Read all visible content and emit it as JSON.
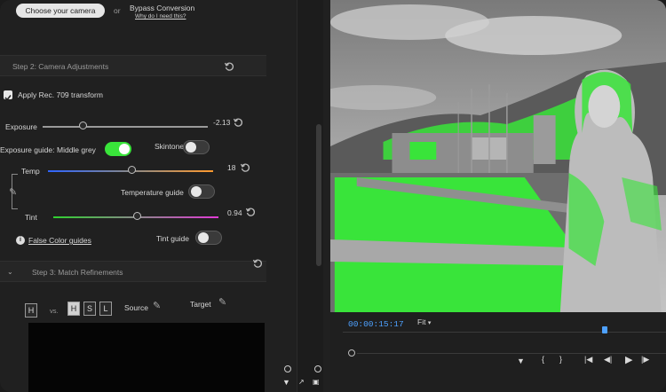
{
  "topbar": {
    "camera_button": "Choose your camera",
    "or_text": "or",
    "bypass_label": "Bypass Conversion",
    "why_link": "Why do I need this?"
  },
  "step2": {
    "title": "Step 2: Camera Adjustments",
    "apply_rec709_label": "Apply Rec. 709 transform",
    "apply_rec709_checked": true,
    "exposure_label": "Exposure",
    "exposure_value": "-2.13",
    "exposure_level": 0.3,
    "exposure_guide_label": "Exposure guide:",
    "middle_grey_label": "Middle grey",
    "middle_grey_on": true,
    "skintones_label": "Skintones",
    "skintones_on": false,
    "temp_label": "Temp",
    "temp_value": "18",
    "temp_level": 0.5,
    "temperature_guide_label": "Temperature guide",
    "temperature_guide_on": false,
    "tint_label": "Tint",
    "tint_value": "0.94",
    "tint_level": 0.5,
    "false_color_link": "False Color guides",
    "tint_guide_label": "Tint guide",
    "tint_guide_on": false
  },
  "step3": {
    "title": "Step 3: Match Refinements",
    "h_label": "H",
    "vs_label": "vs.",
    "hsl_labels": [
      "H",
      "S",
      "L"
    ],
    "source_label": "Source",
    "target_label": "Target"
  },
  "transport": {
    "timecode": "00:00:15:17",
    "fit_label": "Fit",
    "colors": {
      "timecode": "#4ea1ff",
      "false_color": "#39e43a",
      "accent": "#3b5fa8"
    }
  }
}
